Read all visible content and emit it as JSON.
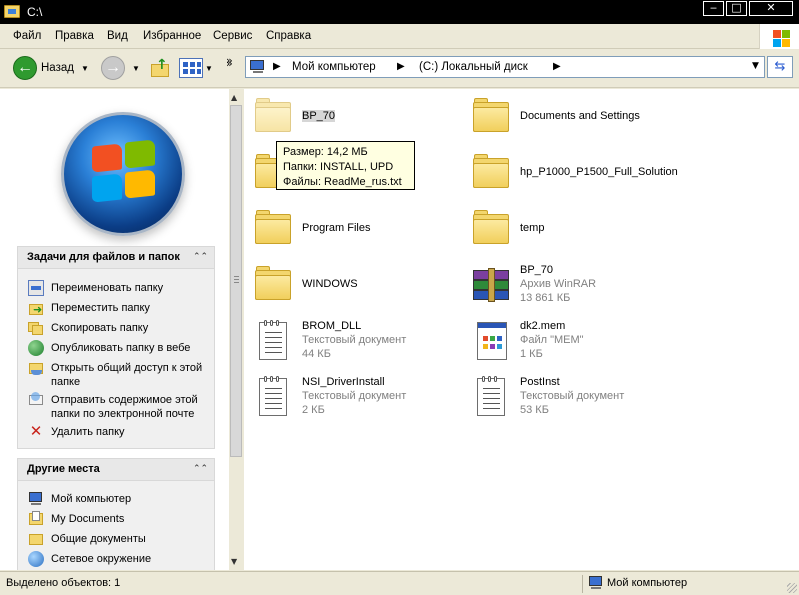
{
  "window": {
    "title": "C:\\",
    "minimize_glyph": "‒",
    "maximize_glyph": "□",
    "close_glyph": "✕"
  },
  "menu": [
    "Файл",
    "Правка",
    "Вид",
    "Избранное",
    "Сервис",
    "Справка"
  ],
  "toolbar": {
    "back_label": "Назад",
    "more_glyph": "»"
  },
  "address": {
    "crumbs": [
      "Мой компьютер",
      "(C:) Локальный диск"
    ]
  },
  "tasks_panel": {
    "title": "Задачи для файлов и папок",
    "items": [
      {
        "label": "Переименовать папку",
        "icon": "rename-icon"
      },
      {
        "label": "Переместить папку",
        "icon": "move-folder-icon"
      },
      {
        "label": "Скопировать папку",
        "icon": "copy-folder-icon"
      },
      {
        "label": "Опубликовать папку в вебе",
        "icon": "publish-web-icon"
      },
      {
        "label": "Открыть общий доступ к этой папке",
        "icon": "share-folder-icon"
      },
      {
        "label": "Отправить содержимое этой папки по электронной почте",
        "icon": "email-icon"
      },
      {
        "label": "Удалить папку",
        "icon": "delete-icon"
      }
    ]
  },
  "places_panel": {
    "title": "Другие места",
    "items": [
      {
        "label": "Мой компьютер",
        "icon": "my-computer-icon"
      },
      {
        "label": "My Documents",
        "icon": "my-documents-icon"
      },
      {
        "label": "Общие документы",
        "icon": "shared-documents-icon"
      },
      {
        "label": "Сетевое окружение",
        "icon": "network-icon"
      }
    ]
  },
  "files": [
    {
      "name": "BP_70",
      "type": "folder",
      "line2": "",
      "line3": "",
      "selected": true
    },
    {
      "name": "Documents and Settings",
      "type": "folder",
      "line2": "",
      "line3": ""
    },
    {
      "name": "",
      "type": "folder",
      "line2": "",
      "line3": ""
    },
    {
      "name": "hp_P1000_P1500_Full_Solution",
      "type": "folder",
      "line2": "",
      "line3": ""
    },
    {
      "name": "Program Files",
      "type": "folder",
      "line2": "",
      "line3": ""
    },
    {
      "name": "temp",
      "type": "folder",
      "line2": "",
      "line3": ""
    },
    {
      "name": "WINDOWS",
      "type": "folder",
      "line2": "",
      "line3": ""
    },
    {
      "name": "BP_70",
      "type": "rar",
      "line2": "Архив WinRAR",
      "line3": "13 861 КБ"
    },
    {
      "name": "BROM_DLL",
      "type": "text",
      "line2": "Текстовый документ",
      "line3": "44 КБ"
    },
    {
      "name": "dk2.mem",
      "type": "mem",
      "line2": "Файл \"MEM\"",
      "line3": "1 КБ"
    },
    {
      "name": "NSI_DriverInstall",
      "type": "text",
      "line2": "Текстовый документ",
      "line3": "2 КБ"
    },
    {
      "name": "PostInst",
      "type": "text",
      "line2": "Текстовый документ",
      "line3": "53 КБ"
    }
  ],
  "tooltip": {
    "lines": [
      "Размер: 14,2 МБ",
      "Папки: INSTALL, UPD",
      "Файлы: ReadMe_rus.txt"
    ]
  },
  "status": {
    "left": "Выделено объектов: 1",
    "right": "Мой компьютер"
  }
}
